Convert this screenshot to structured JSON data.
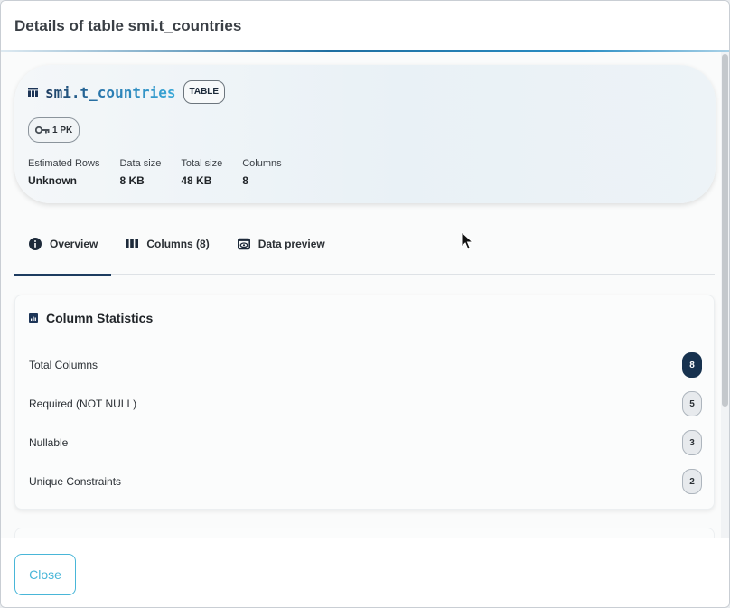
{
  "dialog": {
    "title": "Details of table smi.t_countries"
  },
  "summary": {
    "table_name": "smi.t_countries",
    "type_badge": "TABLE",
    "pk_badge": "1 PK",
    "stats": [
      {
        "label": "Estimated Rows",
        "value": "Unknown"
      },
      {
        "label": "Data size",
        "value": "8 KB"
      },
      {
        "label": "Total size",
        "value": "48 KB"
      },
      {
        "label": "Columns",
        "value": "8"
      }
    ]
  },
  "tabs": [
    {
      "label": "Overview",
      "icon": "info-icon",
      "active": true
    },
    {
      "label": "Columns (8)",
      "icon": "columns-icon",
      "active": false
    },
    {
      "label": "Data preview",
      "icon": "eye-icon",
      "active": false
    }
  ],
  "column_statistics": {
    "title": "Column Statistics",
    "rows": [
      {
        "label": "Total Columns",
        "count": "8"
      },
      {
        "label": "Required (NOT NULL)",
        "count": "5"
      },
      {
        "label": "Nullable",
        "count": "3"
      },
      {
        "label": "Unique Constraints",
        "count": "2"
      }
    ]
  },
  "footer": {
    "close_label": "Close"
  },
  "colors": {
    "primary": "#17324f",
    "accent": "#49b6d8"
  }
}
